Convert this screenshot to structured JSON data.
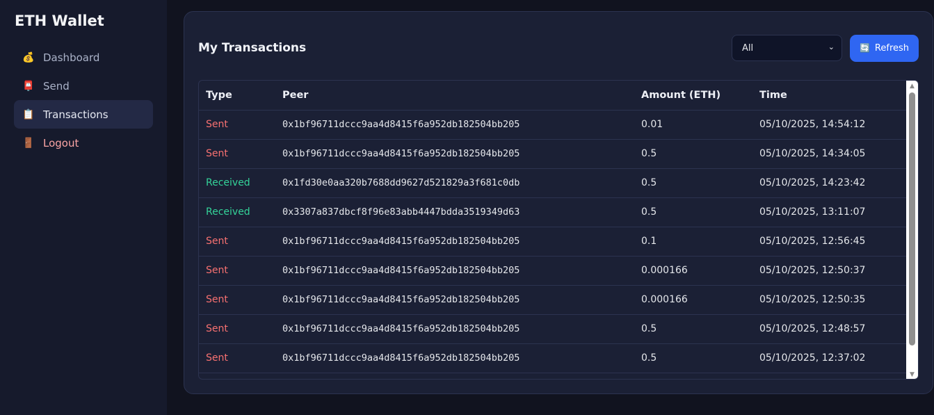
{
  "app": {
    "title": "ETH Wallet"
  },
  "sidebar": {
    "items": [
      {
        "label": "Dashboard",
        "icon": "money-bag-icon",
        "glyph": "💰"
      },
      {
        "label": "Send",
        "icon": "mailbox-icon",
        "glyph": "📮"
      },
      {
        "label": "Transactions",
        "icon": "clipboard-icon",
        "glyph": "📋",
        "active": true
      },
      {
        "label": "Logout",
        "icon": "door-icon",
        "glyph": "🚪"
      }
    ]
  },
  "main": {
    "title": "My Transactions",
    "filter": {
      "selected": "All",
      "chevron": "⌄"
    },
    "refresh": {
      "label": "Refresh",
      "icon": "refresh-icon",
      "glyph": "🔄"
    },
    "table": {
      "headers": {
        "type": "Type",
        "peer": "Peer",
        "amount": "Amount (ETH)",
        "time": "Time"
      },
      "rows": [
        {
          "type": "Sent",
          "peer": "0x1bf96711dccc9aa4d8415f6a952db182504bb205",
          "amount": "0.01",
          "time": "05/10/2025, 14:54:12"
        },
        {
          "type": "Sent",
          "peer": "0x1bf96711dccc9aa4d8415f6a952db182504bb205",
          "amount": "0.5",
          "time": "05/10/2025, 14:34:05"
        },
        {
          "type": "Received",
          "peer": "0x1fd30e0aa320b7688dd9627d521829a3f681c0db",
          "amount": "0.5",
          "time": "05/10/2025, 14:23:42"
        },
        {
          "type": "Received",
          "peer": "0x3307a837dbcf8f96e83abb4447bdda3519349d63",
          "amount": "0.5",
          "time": "05/10/2025, 13:11:07"
        },
        {
          "type": "Sent",
          "peer": "0x1bf96711dccc9aa4d8415f6a952db182504bb205",
          "amount": "0.1",
          "time": "05/10/2025, 12:56:45"
        },
        {
          "type": "Sent",
          "peer": "0x1bf96711dccc9aa4d8415f6a952db182504bb205",
          "amount": "0.000166",
          "time": "05/10/2025, 12:50:37"
        },
        {
          "type": "Sent",
          "peer": "0x1bf96711dccc9aa4d8415f6a952db182504bb205",
          "amount": "0.000166",
          "time": "05/10/2025, 12:50:35"
        },
        {
          "type": "Sent",
          "peer": "0x1bf96711dccc9aa4d8415f6a952db182504bb205",
          "amount": "0.5",
          "time": "05/10/2025, 12:48:57"
        },
        {
          "type": "Sent",
          "peer": "0x1bf96711dccc9aa4d8415f6a952db182504bb205",
          "amount": "0.5",
          "time": "05/10/2025, 12:37:02"
        }
      ]
    },
    "colors": {
      "sent": "#f87171",
      "received": "#34d399",
      "accent": "#2f66f2"
    }
  }
}
